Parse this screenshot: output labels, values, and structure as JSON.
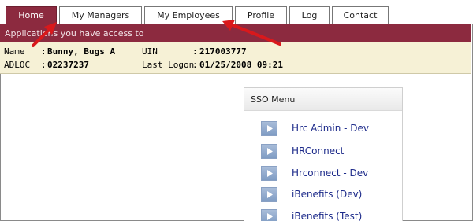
{
  "tabs": [
    {
      "label": "Home",
      "active": true
    },
    {
      "label": "My Managers",
      "active": false
    },
    {
      "label": "My Employees",
      "active": false
    },
    {
      "label": "Profile",
      "active": false
    },
    {
      "label": "Log",
      "active": false
    },
    {
      "label": "Contact",
      "active": false
    }
  ],
  "banner": {
    "text": "Applications you have access to"
  },
  "info": {
    "name_label": "Name",
    "name_value": "Bunny, Bugs A",
    "adloc_label": "ADLOC",
    "adloc_value": "02237237",
    "uin_label": "UIN",
    "uin_value": "217003777",
    "last_logon_label": "Last Logon",
    "last_logon_value": "01/25/2008 09:21",
    "separator": ":"
  },
  "sso": {
    "title": "SSO Menu",
    "items": [
      {
        "label": "Hrc Admin - Dev"
      },
      {
        "label": "HRConnect"
      },
      {
        "label": "Hrconnect - Dev"
      },
      {
        "label": "iBenefits (Dev)"
      },
      {
        "label": "iBenefits (Test)"
      }
    ]
  },
  "colors": {
    "brand": "#8c2a3f",
    "info_bg": "#f6f1d6",
    "link": "#1c2a8a",
    "annotation": "#d9191c"
  },
  "icons": {
    "sso_item": "play-arrow-icon",
    "annotation": "red-arrow-icon"
  }
}
